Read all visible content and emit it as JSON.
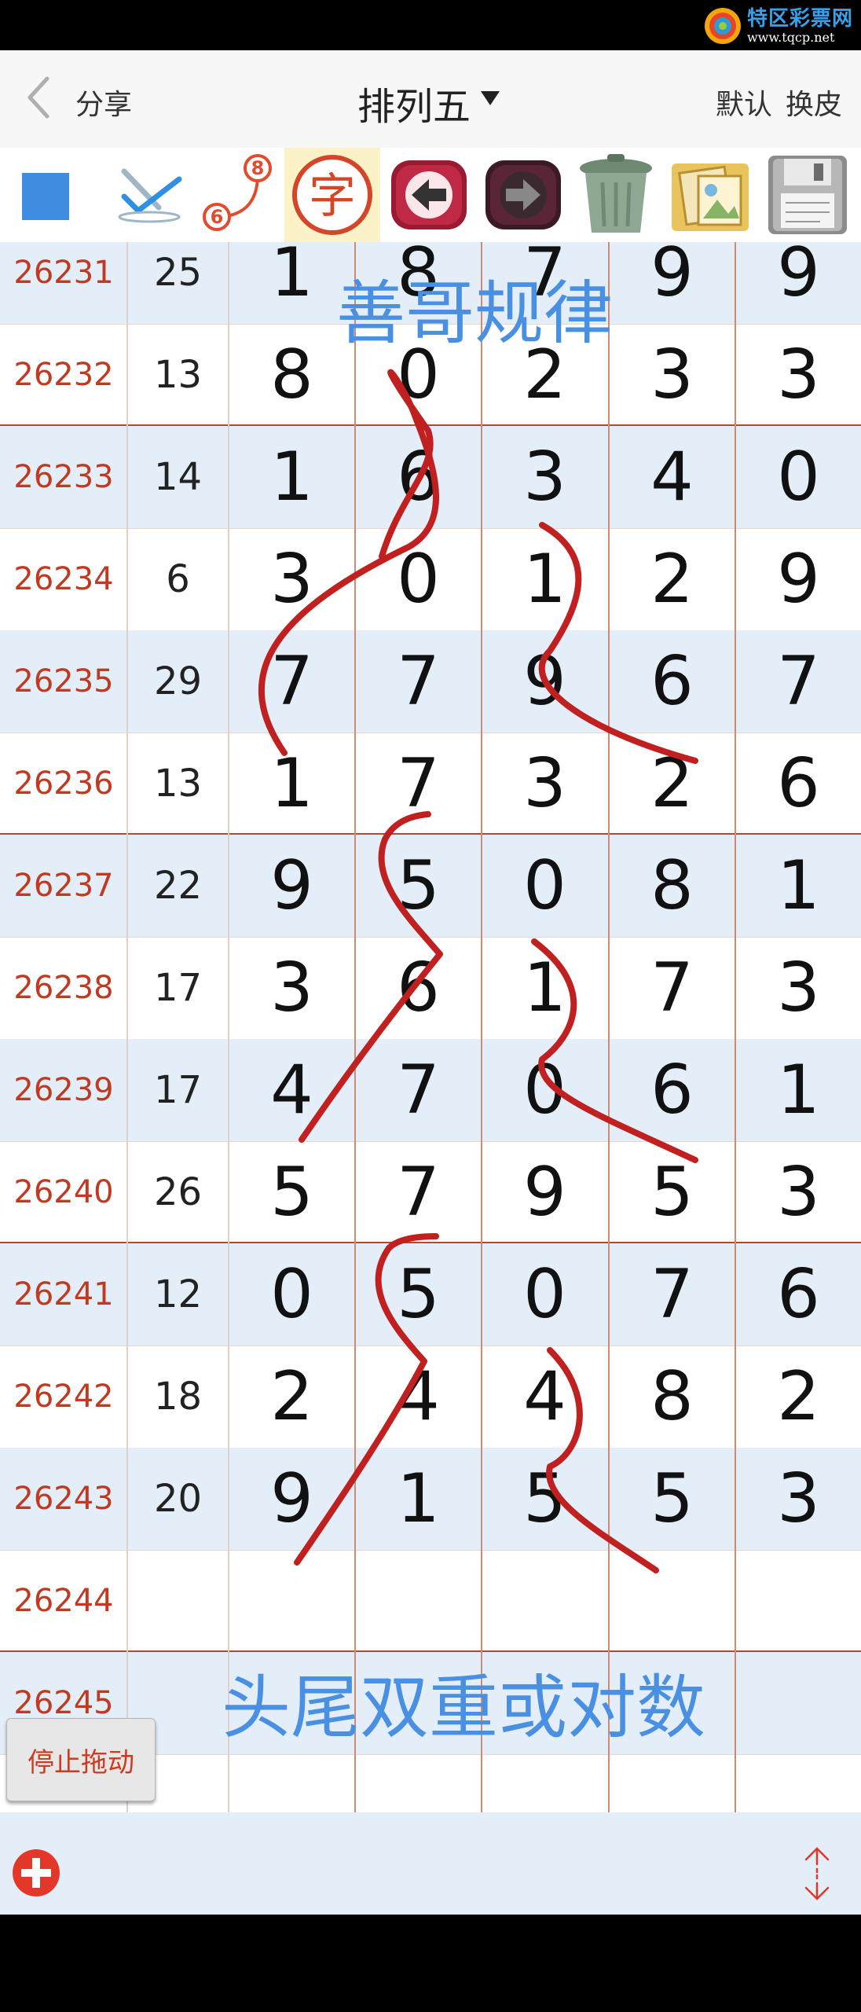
{
  "app": {
    "logo_text": "特区彩票网",
    "logo_url": "www.tqcp.net",
    "title": "排列五",
    "share_label": "分享",
    "default_label": "默认",
    "skin_label": "换皮"
  },
  "icons": {
    "back": "chevron-left-icon",
    "title_dropdown": "caret-down-icon",
    "color_square": "blue-square-icon",
    "pen": "pen-checkmark-icon",
    "connect": "connect-nodes-icon",
    "text": "text-character-icon",
    "undo": "undo-arrow-icon",
    "redo": "redo-arrow-icon",
    "trash": "trash-bin-icon",
    "gallery": "photo-gallery-icon",
    "save": "floppy-disk-icon",
    "add": "plus-circle-icon",
    "scroll": "vertical-scroll-icon"
  },
  "toolbar": {
    "text_tool_char": "字",
    "connect_top_number": "8",
    "connect_bottom_number": "6"
  },
  "colors": {
    "accent": "#4a90e2",
    "issue_number": "#bf3a21",
    "row_alt": "#e3eef9",
    "separator": "#b8452e",
    "stroke": "#c0201f"
  },
  "grid": {
    "rows": [
      {
        "issue": "26231",
        "sum": "25",
        "digits": [
          "1",
          "8",
          "7",
          "9",
          "9"
        ]
      },
      {
        "issue": "26232",
        "sum": "13",
        "digits": [
          "8",
          "0",
          "2",
          "3",
          "3"
        ]
      },
      {
        "issue": "26233",
        "sum": "14",
        "digits": [
          "1",
          "6",
          "3",
          "4",
          "0"
        ]
      },
      {
        "issue": "26234",
        "sum": "6",
        "digits": [
          "3",
          "0",
          "1",
          "2",
          "9"
        ]
      },
      {
        "issue": "26235",
        "sum": "29",
        "digits": [
          "7",
          "7",
          "9",
          "6",
          "7"
        ]
      },
      {
        "issue": "26236",
        "sum": "13",
        "digits": [
          "1",
          "7",
          "3",
          "2",
          "6"
        ]
      },
      {
        "issue": "26237",
        "sum": "22",
        "digits": [
          "9",
          "5",
          "0",
          "8",
          "1"
        ]
      },
      {
        "issue": "26238",
        "sum": "17",
        "digits": [
          "3",
          "6",
          "1",
          "7",
          "3"
        ]
      },
      {
        "issue": "26239",
        "sum": "17",
        "digits": [
          "4",
          "7",
          "0",
          "6",
          "1"
        ]
      },
      {
        "issue": "26240",
        "sum": "26",
        "digits": [
          "5",
          "7",
          "9",
          "5",
          "3"
        ]
      },
      {
        "issue": "26241",
        "sum": "12",
        "digits": [
          "0",
          "5",
          "0",
          "7",
          "6"
        ]
      },
      {
        "issue": "26242",
        "sum": "18",
        "digits": [
          "2",
          "4",
          "4",
          "8",
          "2"
        ]
      },
      {
        "issue": "26243",
        "sum": "20",
        "digits": [
          "9",
          "1",
          "5",
          "5",
          "3"
        ]
      },
      {
        "issue": "26244",
        "sum": "",
        "digits": [
          "",
          "",
          "",
          "",
          ""
        ]
      },
      {
        "issue": "26245",
        "sum": "",
        "digits": [
          "",
          "",
          "",
          "",
          ""
        ]
      },
      {
        "issue": "",
        "sum": "",
        "digits": [
          "",
          "",
          "",
          "",
          ""
        ]
      }
    ]
  },
  "notes": {
    "top": "善哥规律",
    "bottom": "头尾双重或对数"
  },
  "buttons": {
    "stop_drag": "停止拖动"
  }
}
